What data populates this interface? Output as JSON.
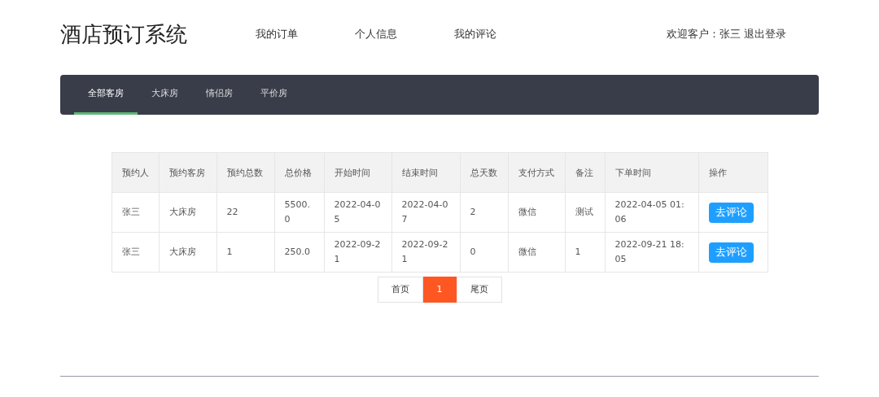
{
  "header": {
    "title": "酒店预订系统",
    "nav": [
      "我的订单",
      "个人信息",
      "我的评论"
    ],
    "welcome": "欢迎客户：张三",
    "logout": "退出登录"
  },
  "tabs": [
    {
      "label": "全部客房",
      "selected": true
    },
    {
      "label": "大床房",
      "selected": false
    },
    {
      "label": "情侣房",
      "selected": false
    },
    {
      "label": "平价房",
      "selected": false
    }
  ],
  "table": {
    "columns": [
      "预约人",
      "预约客房",
      "预约总数",
      "总价格",
      "开始时间",
      "结束时间",
      "总天数",
      "支付方式",
      "备注",
      "下单时间",
      "操作"
    ],
    "rows": [
      {
        "cells": [
          "张三",
          "大床房",
          "22",
          "5500.0",
          "2022-04-05",
          "2022-04-07",
          "2",
          "微信",
          "测试",
          "2022-04-05 01:06"
        ],
        "action": "去评论"
      },
      {
        "cells": [
          "张三",
          "大床房",
          "1",
          "250.0",
          "2022-09-21",
          "2022-09-21",
          "0",
          "微信",
          "1",
          "2022-09-21 18:05"
        ],
        "action": "去评论"
      }
    ]
  },
  "pagination": [
    {
      "label": "首页",
      "selected": false
    },
    {
      "label": "1",
      "selected": true
    },
    {
      "label": "尾页",
      "selected": false
    }
  ]
}
